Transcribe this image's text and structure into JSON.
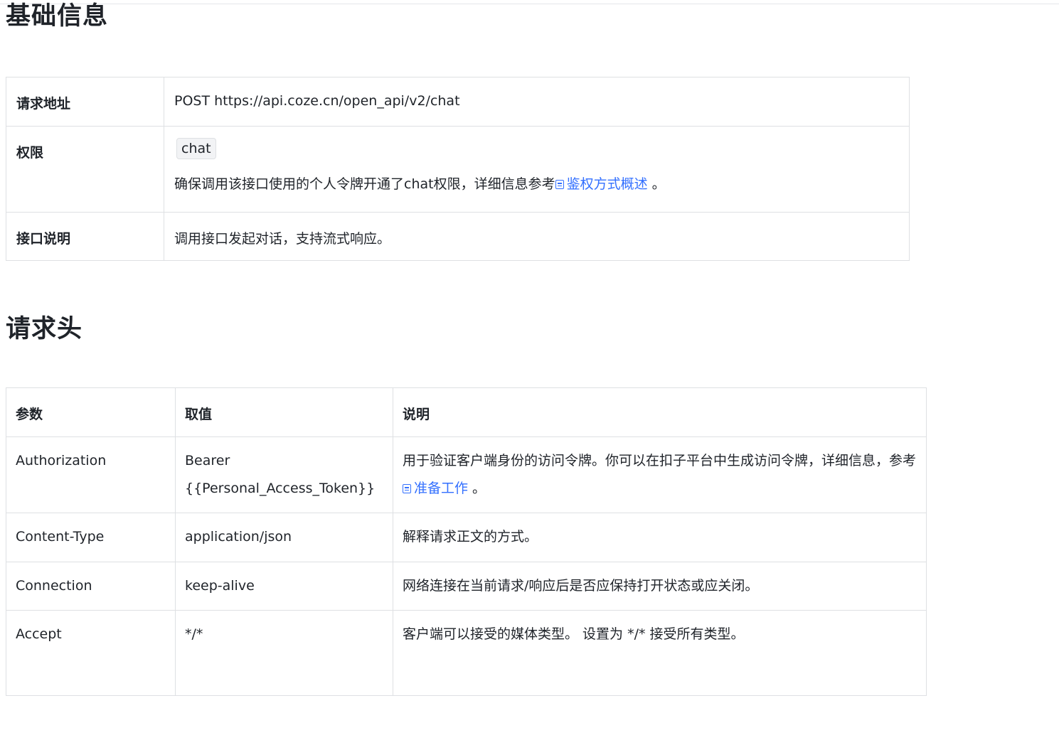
{
  "sections": {
    "basic_title": "基础信息",
    "headers_title": "请求头"
  },
  "basic": {
    "endpoint_label": "请求地址",
    "endpoint_value": "POST https://api.coze.cn/open_api/v2/chat",
    "permission_label": "权限",
    "permission_chip": "chat",
    "permission_desc_before": "确保调用该接口使用的个人令牌开通了chat权限，详细信息参考",
    "permission_link": "鉴权方式概述",
    "permission_desc_after": " 。",
    "description_label": "接口说明",
    "description_value": "调用接口发起对话，支持流式响应。"
  },
  "headers": {
    "columns": [
      "参数",
      "取值",
      "说明"
    ],
    "rows": [
      {
        "param": "Authorization",
        "value_line1": "Bearer",
        "value_line2": "{{Personal_Access_Token}}",
        "desc_before": "用于验证客户端身份的访问令牌。你可以在扣子平台中生成访问令牌，详细信息，参考",
        "desc_link": "准备工作",
        "desc_after": " 。"
      },
      {
        "param": "Content-Type",
        "value": "application/json",
        "desc": "解释请求正文的方式。"
      },
      {
        "param": "Connection",
        "value": "keep-alive",
        "desc": "网络连接在当前请求/响应后是否应保持打开状态或应关闭。"
      },
      {
        "param": "Accept",
        "value": "*/*",
        "desc": "客户端可以接受的媒体类型。 设置为 */* 接受所有类型。"
      }
    ]
  },
  "colors": {
    "link": "#3370ff",
    "border": "#dee0e3",
    "text": "#1f2329"
  }
}
